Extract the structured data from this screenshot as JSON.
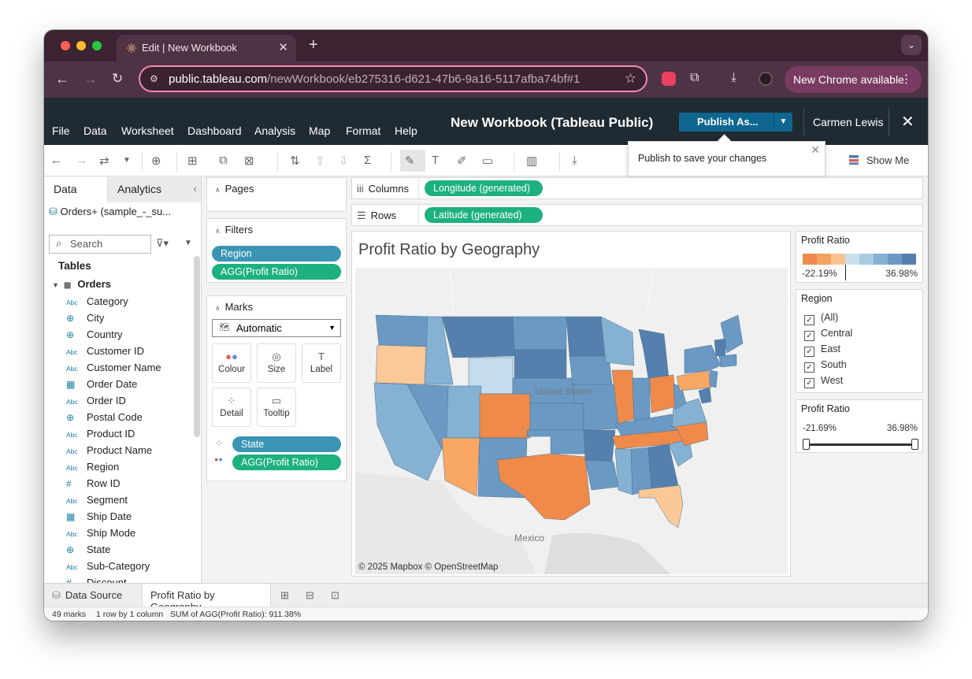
{
  "browser": {
    "tab_title": "Edit | New Workbook",
    "url_host": "public.tableau.com",
    "url_path": "/newWorkbook/eb275316-d621-47b6-9a16-5117afba74bf#1",
    "update_button": "New Chrome available"
  },
  "tableau": {
    "menu": [
      "File",
      "Data",
      "Worksheet",
      "Dashboard",
      "Analysis",
      "Map",
      "Format",
      "Help"
    ],
    "workbook_title": "New Workbook (Tableau Public)",
    "publish_label": "Publish As...",
    "user_name": "Carmen Lewis",
    "callout_text": "Publish to save your changes",
    "show_me": "Show Me"
  },
  "data_pane": {
    "tab_data": "Data",
    "tab_analytics": "Analytics",
    "datasource": "Orders+ (sample_-_su...",
    "search_placeholder": "Search",
    "tables_heading": "Tables",
    "table_name": "Orders",
    "fields": [
      {
        "type": "Abc",
        "name": "Category"
      },
      {
        "type": "globe",
        "name": "City"
      },
      {
        "type": "globe",
        "name": "Country"
      },
      {
        "type": "Abc",
        "name": "Customer ID"
      },
      {
        "type": "Abc",
        "name": "Customer Name"
      },
      {
        "type": "date",
        "name": "Order Date"
      },
      {
        "type": "Abc",
        "name": "Order ID"
      },
      {
        "type": "globe",
        "name": "Postal Code"
      },
      {
        "type": "Abc",
        "name": "Product ID"
      },
      {
        "type": "Abc",
        "name": "Product Name"
      },
      {
        "type": "Abc",
        "name": "Region"
      },
      {
        "type": "#",
        "name": "Row ID"
      },
      {
        "type": "Abc",
        "name": "Segment"
      },
      {
        "type": "date",
        "name": "Ship Date"
      },
      {
        "type": "Abc",
        "name": "Ship Mode"
      },
      {
        "type": "globe",
        "name": "State"
      },
      {
        "type": "Abc",
        "name": "Sub-Category"
      },
      {
        "type": "#",
        "name": "Discount"
      }
    ]
  },
  "cards": {
    "pages": "Pages",
    "filters": "Filters",
    "filter_pills": [
      "Region",
      "AGG(Profit Ratio)"
    ],
    "marks": "Marks",
    "mark_type": "Automatic",
    "mark_buttons": [
      "Colour",
      "Size",
      "Label",
      "Detail",
      "Tooltip"
    ],
    "mark_pills": [
      "State",
      "AGG(Profit Ratio)"
    ]
  },
  "shelves": {
    "columns_label": "Columns",
    "columns_pill": "Longitude (generated)",
    "rows_label": "Rows",
    "rows_pill": "Latitude (generated)"
  },
  "viz": {
    "title": "Profit Ratio by Geography",
    "label_us": "United States",
    "label_mexico": "Mexico",
    "attribution": "© 2025 Mapbox  © OpenStreetMap"
  },
  "legends": {
    "color_title": "Profit Ratio",
    "color_min": "-22.19%",
    "color_max": "36.98%",
    "ramp_colors": [
      "#f08a4b",
      "#f5a15f",
      "#fac28f",
      "#c9dfee",
      "#a8cbe2",
      "#85b1d3",
      "#6a9ac4",
      "#5580ad"
    ],
    "region_title": "Region",
    "region_options": [
      "(All)",
      "Central",
      "East",
      "South",
      "West"
    ],
    "range_title": "Profit Ratio",
    "range_min": "-21.69%",
    "range_max": "36.98%"
  },
  "sheets": {
    "data_source": "Data Source",
    "active_sheet": "Profit Ratio by Geography"
  },
  "status": {
    "marks": "49 marks",
    "dims": "1 row by 1 column",
    "sum": "SUM of AGG(Profit Ratio): 911.38%"
  }
}
